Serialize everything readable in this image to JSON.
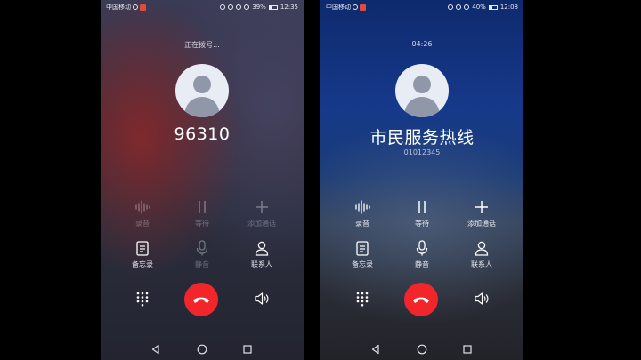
{
  "screens": [
    {
      "status": {
        "carrier": "中国移动",
        "battery": "39%",
        "time": "12:35"
      },
      "call_status": "正在拨号...",
      "caller_name": "96310",
      "caller_number": "",
      "actions": {
        "record": "录音",
        "hold": "等待",
        "add_call": "添加通话",
        "notes": "备忘录",
        "mute": "静音",
        "contacts": "联系人"
      }
    },
    {
      "status": {
        "carrier": "中国移动",
        "battery": "40%",
        "time": "12:08"
      },
      "call_status": "04:26",
      "caller_name": "市民服务热线",
      "caller_number": "01012345",
      "actions": {
        "record": "录音",
        "hold": "等待",
        "add_call": "添加通话",
        "notes": "备忘录",
        "mute": "静音",
        "contacts": "联系人"
      }
    }
  ],
  "colors": {
    "end_call": "#f2262a",
    "left_accent": "#962828",
    "right_accent": "#16398a"
  },
  "icons": [
    "waveform-icon",
    "pause-icon",
    "plus-icon",
    "notes-icon",
    "microphone-icon",
    "person-icon",
    "dialpad-icon",
    "phone-hangup-icon",
    "speaker-icon",
    "back-icon",
    "home-icon",
    "recents-icon"
  ]
}
